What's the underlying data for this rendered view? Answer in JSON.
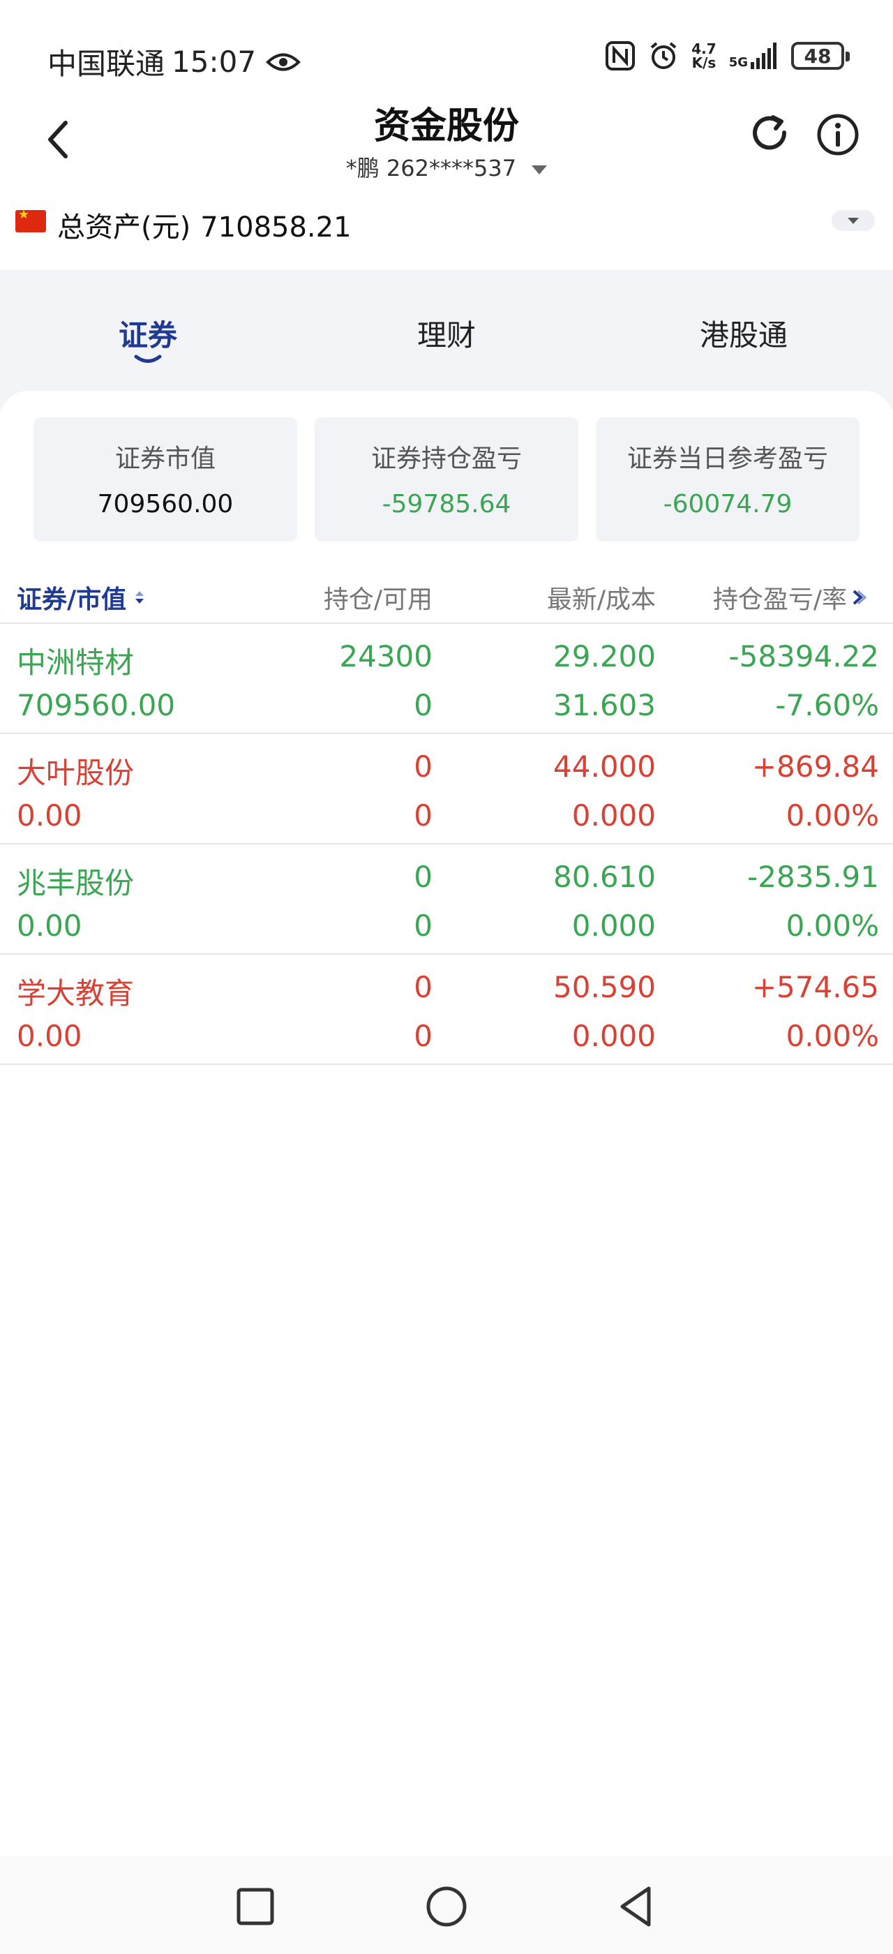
{
  "status_bar": {
    "carrier": "中国联通",
    "time": "15:07",
    "speed_top": "4.7",
    "speed_bottom": "K/s",
    "network": "5G",
    "battery": "48",
    "icons": [
      "eye-icon",
      "nfc-icon",
      "alarm-icon",
      "signal-icon",
      "battery-icon"
    ]
  },
  "header": {
    "title": "资金股份",
    "account": "*鹏 262****537"
  },
  "assets": {
    "label": "总资产(元)",
    "value": "710858.21"
  },
  "tabs": [
    {
      "label": "证券",
      "active": true
    },
    {
      "label": "理财",
      "active": false
    },
    {
      "label": "港股通",
      "active": false
    }
  ],
  "summary": [
    {
      "label": "证券市值",
      "value": "709560.00"
    },
    {
      "label": "证券持仓盈亏",
      "value": "-59785.64"
    },
    {
      "label": "证券当日参考盈亏",
      "value": "-60074.79"
    }
  ],
  "table": {
    "headers": [
      "证券/市值",
      "持仓/可用",
      "最新/成本",
      "持仓盈亏/率"
    ],
    "rows": [
      {
        "name": "中洲特材",
        "market_value": "709560.00",
        "position": "24300",
        "available": "0",
        "latest": "29.200",
        "cost": "31.603",
        "pl": "-58394.22",
        "pl_rate": "-7.60%",
        "color": "green"
      },
      {
        "name": "大叶股份",
        "market_value": "0.00",
        "position": "0",
        "available": "0",
        "latest": "44.000",
        "cost": "0.000",
        "pl": "+869.84",
        "pl_rate": "0.00%",
        "color": "red"
      },
      {
        "name": "兆丰股份",
        "market_value": "0.00",
        "position": "0",
        "available": "0",
        "latest": "80.610",
        "cost": "0.000",
        "pl": "-2835.91",
        "pl_rate": "0.00%",
        "color": "green"
      },
      {
        "name": "学大教育",
        "market_value": "0.00",
        "position": "0",
        "available": "0",
        "latest": "50.590",
        "cost": "0.000",
        "pl": "+574.65",
        "pl_rate": "0.00%",
        "color": "red"
      }
    ]
  },
  "colors": {
    "accent": "#1f3a93",
    "loss": "#3aa552",
    "gain": "#d94134"
  }
}
